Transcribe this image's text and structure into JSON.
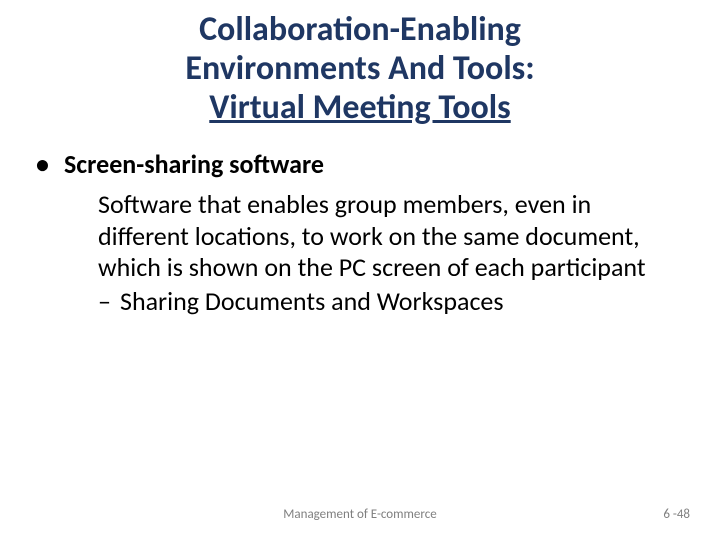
{
  "title": {
    "line1": "Collaboration-Enabling",
    "line2": "Environments And Tools:",
    "line3": "Virtual Meeting Tools"
  },
  "body": {
    "bullet_marker": "•",
    "bullet1_label": "Screen-sharing software",
    "description": "Software that enables group members, even in different locations, to work on the same document, which is shown on the PC screen of each participant",
    "dash_marker": "–",
    "sub1_label": "Sharing Documents and Workspaces"
  },
  "footer": {
    "center": "Management of E-commerce",
    "right": "6 -48"
  }
}
